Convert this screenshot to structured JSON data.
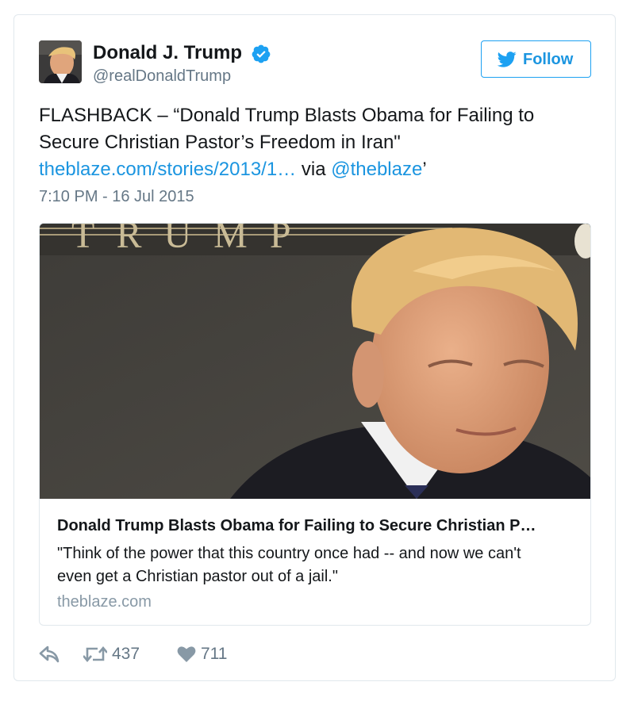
{
  "user": {
    "name": "Donald J. Trump",
    "handle": "@realDonaldTrump",
    "verified": true
  },
  "follow_button": {
    "label": "Follow"
  },
  "tweet": {
    "text_line1": "FLASHBACK – “Donald Trump Blasts Obama for Failing to",
    "text_line2": "Secure Christian Pastor’s Freedom in Iran\"",
    "link": "theblaze.com/stories/2013/1…",
    "via": "via",
    "mention": "@theblaze",
    "trailing": "’",
    "timestamp": "7:10 PM - 16 Jul 2015"
  },
  "card": {
    "image_text": "T R U M P",
    "title": "Donald Trump Blasts Obama for Failing to Secure Christian P…",
    "description_line1": "\"Think of the power that this country once had -- and now we can't",
    "description_line2": "even get a Christian pastor out of a jail.\"",
    "domain": "theblaze.com"
  },
  "actions": {
    "retweets": "437",
    "likes": "711"
  },
  "colors": {
    "link": "#1b95e0",
    "muted": "#657786",
    "border": "#e1e8ed",
    "verified": "#1da1f2"
  },
  "icons": [
    "avatar-photo",
    "verified-badge-icon",
    "twitter-bird-icon",
    "reply-icon",
    "retweet-icon",
    "heart-icon"
  ]
}
